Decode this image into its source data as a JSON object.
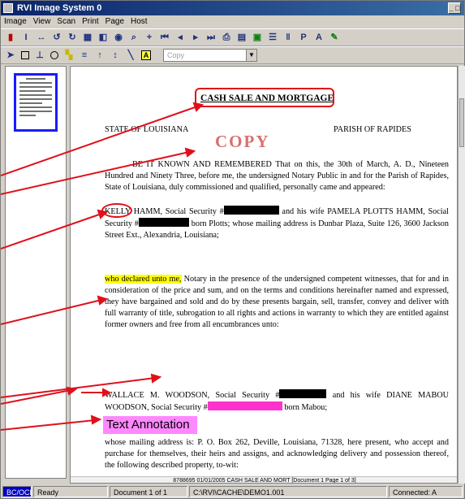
{
  "window": {
    "title": "RVI Image System 0",
    "minimize_glyph": "_ □"
  },
  "menu": [
    "Image",
    "View",
    "Scan",
    "Print",
    "Page",
    "Host"
  ],
  "toolbar1": {
    "icons": [
      "bookmark-red-icon",
      "bookmark-icon",
      "page-width-icon",
      "rotate-left-icon",
      "rotate-right-icon",
      "thumbnails-icon",
      "scan-icon",
      "camera-icon",
      "zoom-icon",
      "crosshair-icon",
      "first-page-icon",
      "prev-page-icon",
      "next-page-icon",
      "last-page-icon",
      "print-icon",
      "fax-icon",
      "annotate-icon",
      "highlight-icon",
      "bars-icon",
      "pen-icon",
      "text-a-icon",
      "marker-icon"
    ]
  },
  "toolbar2": {
    "icons": [
      "select-arrow-icon",
      "rectangle-icon",
      "stamp-icon",
      "ellipse-icon",
      "highlighter-icon",
      "lines-icon",
      "arrow-up-icon",
      "double-arrow-icon",
      "diagonal-line-icon",
      "text-box-icon"
    ],
    "combo_value": "Copy"
  },
  "document": {
    "title": "CASH SALE AND MORTGAGE",
    "state": "STATE OF LOUISIANA",
    "parish": "PARISH OF RAPIDES",
    "stamp": "COPY",
    "p1": "BE IT KNOWN AND REMEMBERED That on this, the 30th of March, A. D., Nineteen Hundred and Ninety Three, before me, the undersigned Notary Public in and for the Parish of Rapides, State of Louisiana, duly commissioned and qualified, personally came and appeared:",
    "p2_name": "KELLY",
    "p2_a": " HAMM, Social Security #",
    "p2_b": " and his wife PAMELA PLOTTS HAMM, Social Security #",
    "p2_c": " born Plotts; whose mailing address is Dunbar Plaza, Suite 126, 3600 Jackson Street Ext., Alexandria, Louisiana;",
    "p3_highlight": "who declared unto me,",
    "p3_rest": " Notary in the presence of the undersigned competent witnesses, that for and in consideration of the price and sum, and on the terms and conditions hereinafter named and expressed, they have bargained and sold and do by these presents bargain, sell, transfer, convey and deliver with full warranty of title, subrogation to all rights and actions in warranty to which they are entitled against former owners and free from all encumbrances unto:",
    "p4_a": "WALLACE M. WOODSON, Social Security #",
    "p4_b": " and his wife DIANE MABOU WOODSON, Social Security #",
    "p4_c": " born Mabou;",
    "text_annotation": "Text Annotation",
    "p5": "whose mailing address is: P. O. Box 262, Deville, Louisiana, 71328, here present, who accept and purchase for themselves, their heirs and assigns, and acknowledging delivery and possession thereof, the following described property, to-wit:",
    "footer": "8788695 01/01/2005 CASH SALE AND MORT [Document 1 Page 1 of 3]"
  },
  "statusbar": {
    "mode": "BC/OCR",
    "ready": "Ready",
    "doc": "Document 1 of 1",
    "path": "C:\\RVI\\CACHE\\DEMO1.001",
    "conn": "Connected: A"
  },
  "colors": {
    "annotation_red": "#e0101a",
    "highlight_yellow": "#ffff00",
    "text_annotation_pink": "#ff88ff",
    "magenta_redaction": "#ff33cc",
    "stamp_color": "#d87070"
  }
}
